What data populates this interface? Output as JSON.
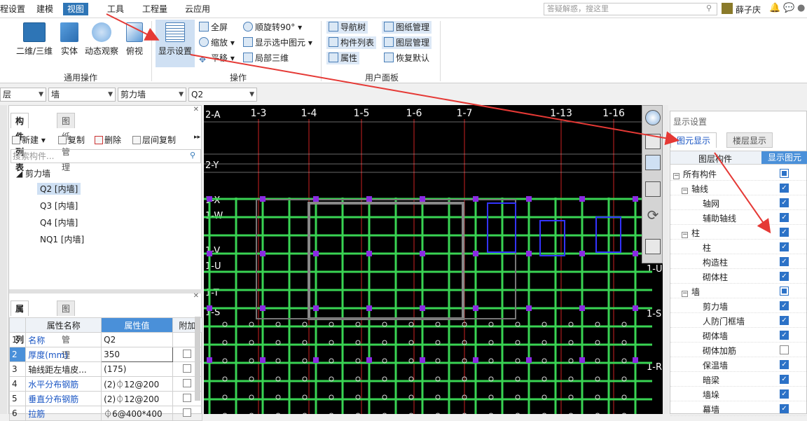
{
  "menubar": {
    "items": [
      "程设置",
      "建模",
      "视图",
      "工具",
      "工程量",
      "云应用"
    ],
    "active_index": 2,
    "search_placeholder": "答疑解惑，搜这里",
    "user_name": "薛子庆"
  },
  "ribbon": {
    "groups": {
      "common": {
        "label": "通用操作",
        "buttons": [
          "二维/三维",
          "实体",
          "动态观察",
          "俯视"
        ]
      },
      "ops": {
        "label": "操作",
        "display_settings": "显示设置",
        "items": [
          "全屏",
          "顺旋转90°",
          "缩放",
          "显示选中图元",
          "平移",
          "局部三维"
        ]
      },
      "user_panel": {
        "label": "用户面板",
        "items": [
          "导航树",
          "图纸管理",
          "构件列表",
          "图层管理",
          "属性",
          "恢复默认"
        ]
      }
    }
  },
  "toolbar2": {
    "floor": "层",
    "type": "墙",
    "subtype": "剪力墙",
    "component": "Q2"
  },
  "left_panel": {
    "tabs": [
      "构件列表",
      "图纸管理"
    ],
    "actions": [
      "新建",
      "复制",
      "删除",
      "层间复制"
    ],
    "search_placeholder": "搜索构件...",
    "tree_root": "剪力墙",
    "tree_items": [
      "Q2 [内墙]",
      "Q3 [内墙]",
      "Q4 [内墙]",
      "NQ1 [内墙]"
    ],
    "prop_tabs": [
      "属性列表",
      "图层管理"
    ],
    "prop_headers": [
      "属性名称",
      "属性值",
      "附加"
    ],
    "props": [
      {
        "n": "1",
        "name": "名称",
        "value": "Q2"
      },
      {
        "n": "2",
        "name": "厚度(mm)",
        "value": "350"
      },
      {
        "n": "3",
        "name": "轴线距左墙皮...",
        "value": "(175)"
      },
      {
        "n": "4",
        "name": "水平分布钢筋",
        "value": "(2)⏀12@200"
      },
      {
        "n": "5",
        "name": "垂直分布钢筋",
        "value": "(2)⏀12@200"
      },
      {
        "n": "6",
        "name": "拉筋",
        "value": "⏀6@400*400"
      }
    ]
  },
  "canvas": {
    "top_axes": [
      "1-3",
      "1-4",
      "1-5",
      "1-6",
      "1-7",
      "1-13",
      "1-16"
    ],
    "left_axes": [
      "2-A",
      "2-Y",
      "1-X",
      "1-W",
      "1-V",
      "1-U",
      "1-T",
      "1-S"
    ],
    "right_axes": [
      "1-U",
      "1-S",
      "1-R"
    ]
  },
  "right_panel": {
    "title": "显示设置",
    "tabs": [
      "图元显示",
      "楼层显示"
    ],
    "headers": [
      "图层构件",
      "显示图元"
    ],
    "rows": [
      {
        "label": "所有构件",
        "level": 0,
        "exp": "−",
        "state": "partial"
      },
      {
        "label": "轴线",
        "level": 1,
        "exp": "−",
        "state": "on"
      },
      {
        "label": "轴网",
        "level": 2,
        "exp": "",
        "state": "on"
      },
      {
        "label": "辅助轴线",
        "level": 2,
        "exp": "",
        "state": "on"
      },
      {
        "label": "柱",
        "level": 1,
        "exp": "−",
        "state": "on"
      },
      {
        "label": "柱",
        "level": 2,
        "exp": "",
        "state": "on"
      },
      {
        "label": "构造柱",
        "level": 2,
        "exp": "",
        "state": "on"
      },
      {
        "label": "砌体柱",
        "level": 2,
        "exp": "",
        "state": "on"
      },
      {
        "label": "墙",
        "level": 1,
        "exp": "−",
        "state": "partial"
      },
      {
        "label": "剪力墙",
        "level": 2,
        "exp": "",
        "state": "on"
      },
      {
        "label": "人防门框墙",
        "level": 2,
        "exp": "",
        "state": "on"
      },
      {
        "label": "砌体墙",
        "level": 2,
        "exp": "",
        "state": "on"
      },
      {
        "label": "砌体加筋",
        "level": 2,
        "exp": "",
        "state": "off"
      },
      {
        "label": "保温墙",
        "level": 2,
        "exp": "",
        "state": "on"
      },
      {
        "label": "暗梁",
        "level": 2,
        "exp": "",
        "state": "on"
      },
      {
        "label": "墙垛",
        "level": 2,
        "exp": "",
        "state": "on"
      },
      {
        "label": "幕墙",
        "level": 2,
        "exp": "",
        "state": "on"
      }
    ]
  },
  "colors": {
    "accent": "#2e75b6",
    "annotation_arrow": "#e53935",
    "canvas_bg": "#000000",
    "wall_green": "#39d353",
    "column_purple": "#8a2be2"
  }
}
